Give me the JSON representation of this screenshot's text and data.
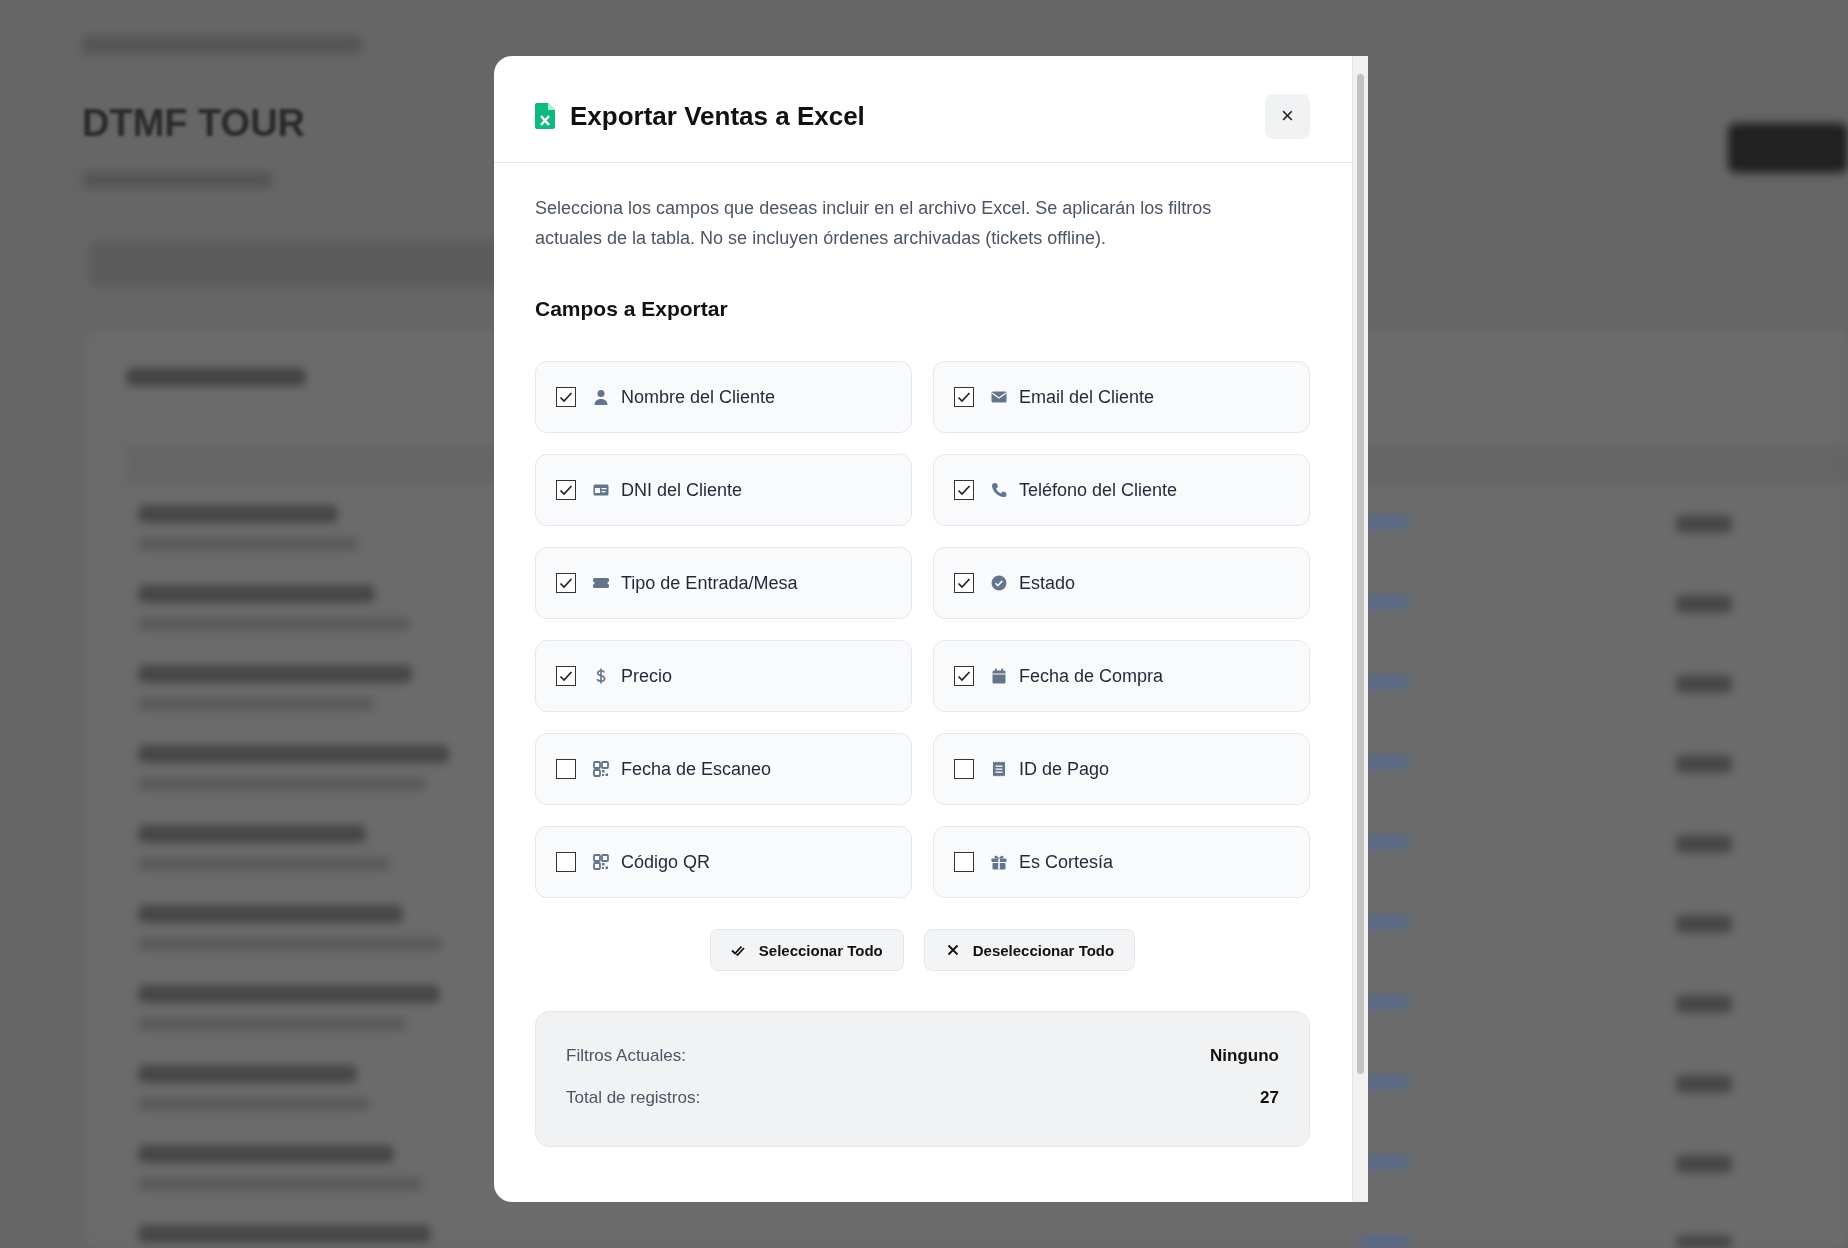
{
  "page": {
    "title": "DTMF TOUR"
  },
  "dialog": {
    "title": "Exportar Ventas a Excel",
    "close": "×",
    "description": "Selecciona los campos que deseas incluir en el archivo Excel. Se aplicarán los filtros actuales de la tabla. No se incluyen órdenes archivadas (tickets offline).",
    "section_title": "Campos a Exportar",
    "fields": [
      {
        "label": "Nombre del Cliente",
        "checked": true
      },
      {
        "label": "Email del Cliente",
        "checked": true
      },
      {
        "label": "DNI del Cliente",
        "checked": true
      },
      {
        "label": "Teléfono del Cliente",
        "checked": true
      },
      {
        "label": "Tipo de Entrada/Mesa",
        "checked": true
      },
      {
        "label": "Estado",
        "checked": true
      },
      {
        "label": "Precio",
        "checked": true
      },
      {
        "label": "Fecha de Compra",
        "checked": true
      },
      {
        "label": "Fecha de Escaneo",
        "checked": false
      },
      {
        "label": "ID de Pago",
        "checked": false
      },
      {
        "label": "Código QR",
        "checked": false
      },
      {
        "label": "Es Cortesía",
        "checked": false
      }
    ],
    "buttons": [
      {
        "kind": "select",
        "label": "Seleccionar Todo"
      },
      {
        "kind": "deselect",
        "label": "Deseleccionar Todo"
      }
    ],
    "summary": [
      {
        "label": "Filtros Actuales:",
        "value": "Ninguno"
      },
      {
        "label": "Total de registros:",
        "value": "27"
      }
    ]
  }
}
